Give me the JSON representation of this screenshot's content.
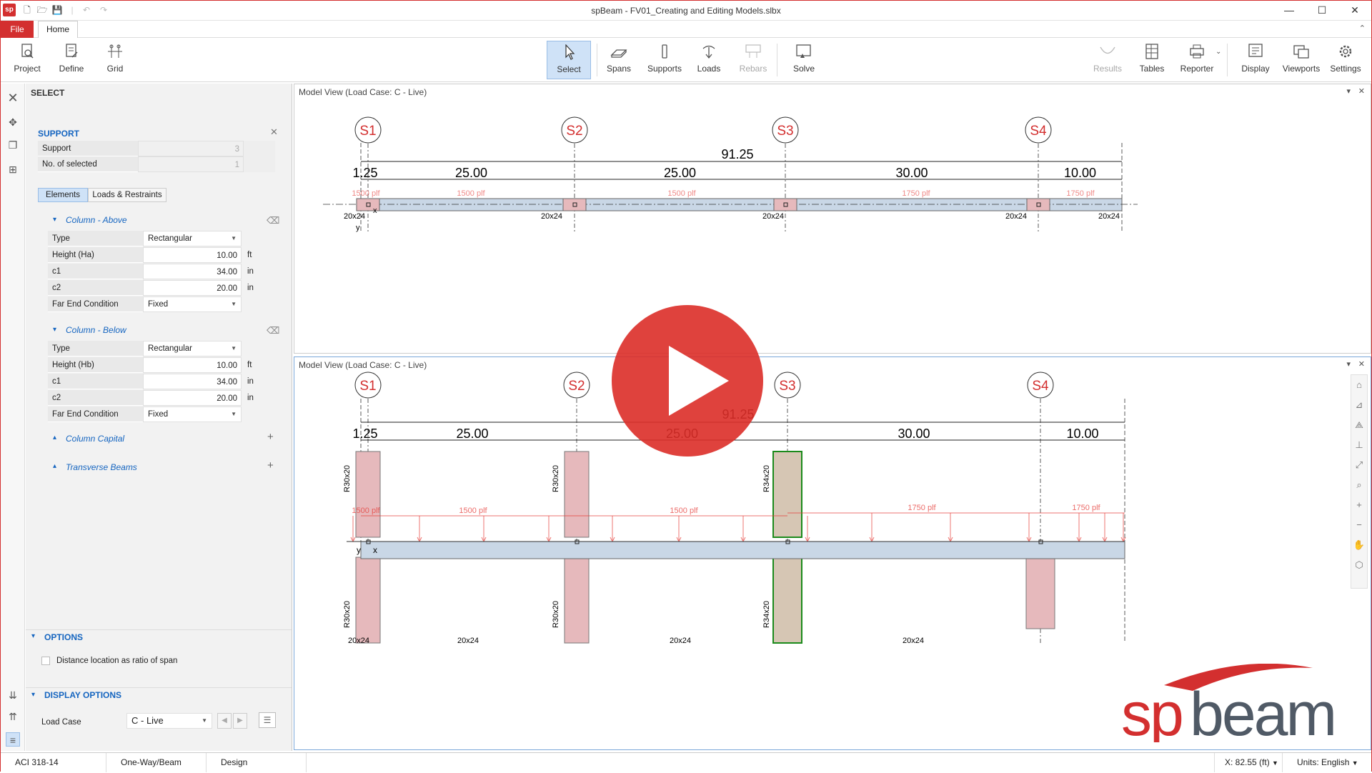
{
  "window": {
    "title": "spBeam - FV01_Creating and Editing Models.slbx",
    "app_icon": "sp",
    "minimize": "—",
    "maximize": "☐",
    "close": "✕"
  },
  "menu": {
    "file": "File",
    "home": "Home",
    "collapse": "⌃"
  },
  "ribbon": {
    "project": "Project",
    "define": "Define",
    "grid": "Grid",
    "select": "Select",
    "spans": "Spans",
    "supports": "Supports",
    "loads": "Loads",
    "rebars": "Rebars",
    "solve": "Solve",
    "results": "Results",
    "tables": "Tables",
    "reporter": "Reporter",
    "display": "Display",
    "viewports": "Viewports",
    "settings": "Settings"
  },
  "panel": {
    "title": "SELECT",
    "section": "SUPPORT",
    "summary": [
      {
        "label": "Support",
        "value": "3"
      },
      {
        "label": "No. of selected",
        "value": "1"
      }
    ],
    "tabs": [
      "Elements",
      "Loads & Restraints"
    ],
    "column_above": {
      "title": "Column - Above",
      "rows": [
        {
          "label": "Type",
          "value": "Rectangular",
          "unit": "",
          "select": true
        },
        {
          "label": "Height (Ha)",
          "value": "10.00",
          "unit": "ft",
          "select": false
        },
        {
          "label": "c1",
          "value": "34.00",
          "unit": "in",
          "select": false
        },
        {
          "label": "c2",
          "value": "20.00",
          "unit": "in",
          "select": false
        },
        {
          "label": "Far End Condition",
          "value": "Fixed",
          "unit": "",
          "select": true
        }
      ]
    },
    "column_below": {
      "title": "Column - Below",
      "rows": [
        {
          "label": "Type",
          "value": "Rectangular",
          "unit": "",
          "select": true
        },
        {
          "label": "Height (Hb)",
          "value": "10.00",
          "unit": "ft",
          "select": false
        },
        {
          "label": "c1",
          "value": "34.00",
          "unit": "in",
          "select": false
        },
        {
          "label": "c2",
          "value": "20.00",
          "unit": "in",
          "select": false
        },
        {
          "label": "Far End Condition",
          "value": "Fixed",
          "unit": "",
          "select": true
        }
      ]
    },
    "column_capital": "Column Capital",
    "transverse_beams": "Transverse Beams",
    "options": "OPTIONS",
    "option_distance": "Distance location as ratio of span",
    "display_options": "DISPLAY OPTIONS",
    "load_case_label": "Load Case",
    "load_case_value": "C - Live"
  },
  "status": {
    "code": "ACI 318-14",
    "system": "One-Way/Beam",
    "mode": "Design",
    "coord": "X: 82.55 (ft)",
    "units_label": "Units:",
    "units_value": "English"
  },
  "viewport_top": {
    "title": "Model View (Load Case: C - Live)"
  },
  "viewport_bottom": {
    "title": "Model View (Load Case: C - Live)"
  },
  "model": {
    "supports": [
      "S1",
      "S2",
      "S3",
      "S4"
    ],
    "total_length": "91.25",
    "dims": [
      "1.25",
      "25.00",
      "25.00",
      "30.00",
      "10.00"
    ],
    "loads_top": [
      "1500 plf",
      "1500 plf",
      "1500 plf",
      "1750 plf",
      "1750 plf"
    ],
    "loads_bottom": [
      "1500 plf",
      "1500 plf",
      "1500 plf",
      "1750 plf",
      "1750 plf"
    ],
    "beam_sections": [
      "20x24",
      "20x24",
      "20x24",
      "20x24",
      "20x24"
    ],
    "col_labels": [
      "R30x20",
      "R30x20",
      "R34x20",
      "R30x20"
    ],
    "axis_x": "x",
    "axis_y": "y"
  },
  "logo": {
    "text_sp": "sp",
    "text_beam": "beam"
  },
  "colors": {
    "accent": "#d32f2f",
    "beam": "#c9d7e6",
    "column": "#e6b9bc",
    "selected": "#1b8a1b",
    "load": "#e53935",
    "select_bg": "#cfe2f7"
  }
}
